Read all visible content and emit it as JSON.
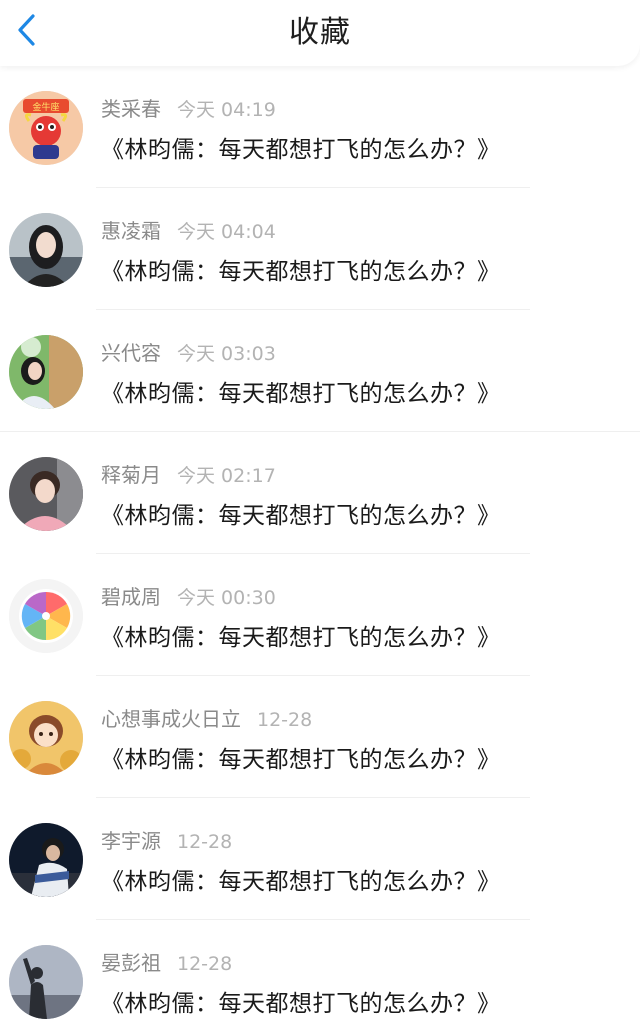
{
  "header": {
    "title": "收藏",
    "back_icon": "chevron-left-icon",
    "accent_color": "#1e88e5"
  },
  "items": [
    {
      "name": "类采春",
      "time": "今天 04:19",
      "content": "《林昀儒：每天都想打飞的怎么办？》",
      "avatar": "cartoon-taurus-avatar"
    },
    {
      "name": "惠凌霜",
      "time": "今天 04:04",
      "content": "《林昀儒：每天都想打飞的怎么办？》",
      "avatar": "girl-portrait-avatar"
    },
    {
      "name": "兴代容",
      "time": "今天 03:03",
      "content": "《林昀儒：每天都想打飞的怎么办？》",
      "avatar": "girl-outdoor-avatar"
    },
    {
      "name": "释菊月",
      "time": "今天 02:17",
      "content": "《林昀儒：每天都想打飞的怎么办？》",
      "avatar": "boy-pink-avatar"
    },
    {
      "name": "碧成周",
      "time": "今天 00:30",
      "content": "《林昀儒：每天都想打飞的怎么办？》",
      "avatar": "rainbow-citrus-avatar"
    },
    {
      "name": "心想事成火日立",
      "time": "12-28",
      "content": "《林昀儒：每天都想打飞的怎么办？》",
      "avatar": "cartoon-girl-gold-avatar"
    },
    {
      "name": "李宇源",
      "time": "12-28",
      "content": "《林昀儒：每天都想打飞的怎么办？》",
      "avatar": "boy-night-avatar"
    },
    {
      "name": "晏彭祖",
      "time": "12-28",
      "content": "《林昀儒：每天都想打飞的怎么办？》",
      "avatar": "silhouette-sky-avatar"
    }
  ]
}
